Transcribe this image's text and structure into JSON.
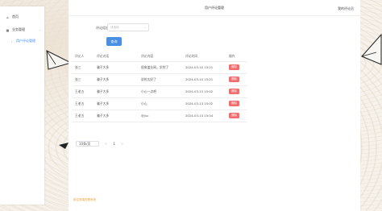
{
  "sidebar": {
    "items": [
      {
        "icon": "home-icon",
        "label": "首页"
      },
      {
        "icon": "grid-icon",
        "label": "业务管理",
        "expand_icon": "chevron-icon"
      },
      {
        "icon": "arrow-right-icon",
        "label": "用户评论管理"
      }
    ]
  },
  "header": {
    "title": "用户评论管理",
    "user_menu": "我的评论员"
  },
  "filter": {
    "label": "评论组名",
    "placeholder": "请选择",
    "query_label": "查询"
  },
  "table": {
    "columns": [
      "评论人",
      "评论对话",
      "评论内容",
      "评论时间",
      "操作"
    ],
    "rows": [
      {
        "user": "张三",
        "target": "骗子大多",
        "content": "很来盖业网，学到了",
        "time": "2024-03-10 15:21",
        "action": "删除"
      },
      {
        "user": "张三",
        "target": "骗子大多",
        "content": "说的太好了",
        "time": "2024-03-10 15:21",
        "action": "删除"
      },
      {
        "user": "王老五",
        "target": "骗子大多",
        "content": "小心一点吧",
        "time": "2024-03-13 15:02",
        "action": "删除"
      },
      {
        "user": "王老五",
        "target": "骗子大多",
        "content": "小心",
        "time": "2024-03-13 15:02",
        "action": "删除"
      },
      {
        "user": "王老五",
        "target": "骗子大多",
        "content": "@jiui",
        "time": "2024-03-13 15:04",
        "action": "删除"
      }
    ]
  },
  "pagination": {
    "page_size": "10条/页",
    "prev": "<",
    "current": "1",
    "next": ">"
  },
  "footer": {
    "link": "前往前端查看系统"
  },
  "colors": {
    "primary": "#4a90e2",
    "danger": "#f56c6c",
    "link": "#e6a23c"
  }
}
